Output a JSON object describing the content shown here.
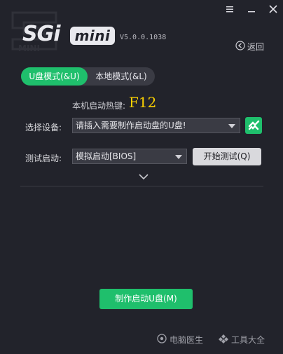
{
  "header": {
    "logo_main": "SGi",
    "logo_badge": "mini",
    "watermark_text": "MINI",
    "version": "V5.0.0.1038",
    "back_label": "返回"
  },
  "tabs": [
    {
      "label": "U盘模式(&U)",
      "active": true
    },
    {
      "label": "本地模式(&L)",
      "active": false
    }
  ],
  "hotkey": {
    "label": "本机启动热键:",
    "value": "F12"
  },
  "device": {
    "label": "选择设备:",
    "selected": "请插入需要制作启动盘的U盘!"
  },
  "test": {
    "label": "测试启动:",
    "selected": "模拟启动[BIOS]",
    "start_label": "开始测试(Q)"
  },
  "actions": {
    "make_label": "制作启动U盘(M)"
  },
  "footer": {
    "doctor_label": "电脑医生",
    "tools_label": "工具大全"
  },
  "colors": {
    "background": "#22232b",
    "accent": "#1fbf6c",
    "hotkey": "#ffd300"
  }
}
